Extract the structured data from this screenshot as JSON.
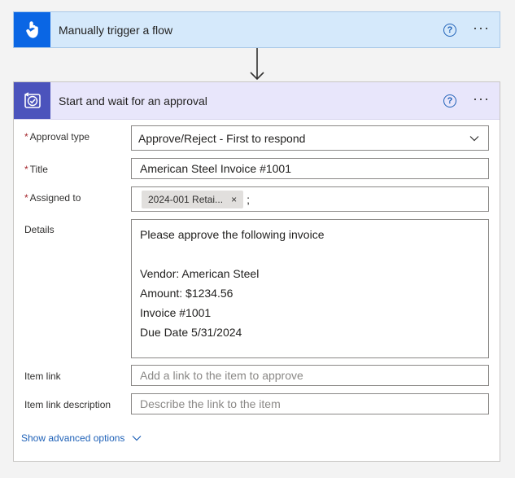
{
  "trigger": {
    "title": "Manually trigger a flow",
    "help": "?",
    "more": "···",
    "icon": "hand-touch-icon"
  },
  "approval": {
    "title": "Start and wait for an approval",
    "help": "?",
    "more": "···",
    "icon": "approval-check-icon",
    "fields": {
      "approval_type": {
        "required": "*",
        "label": "Approval type",
        "value": "Approve/Reject - First to respond"
      },
      "title": {
        "required": "*",
        "label": "Title",
        "value": "American Steel Invoice #1001"
      },
      "assigned_to": {
        "required": "*",
        "label": "Assigned to",
        "token": "2024-001 Retai...",
        "remove": "×",
        "separator": ";"
      },
      "details": {
        "label": "Details",
        "lines": [
          "Please approve the following invoice",
          "",
          "Vendor: American Steel",
          "Amount: $1234.56",
          "Invoice #1001",
          "Due Date 5/31/2024"
        ]
      },
      "item_link": {
        "label": "Item link",
        "placeholder": "Add a link to the item to approve"
      },
      "item_link_description": {
        "label": "Item link description",
        "placeholder": "Describe the link to the item"
      }
    },
    "advanced_label": "Show advanced options"
  },
  "colors": {
    "trigger_accent": "#0a66e4",
    "approval_accent": "#4b53bc",
    "link": "#2062b8",
    "required": "#a4262c"
  }
}
